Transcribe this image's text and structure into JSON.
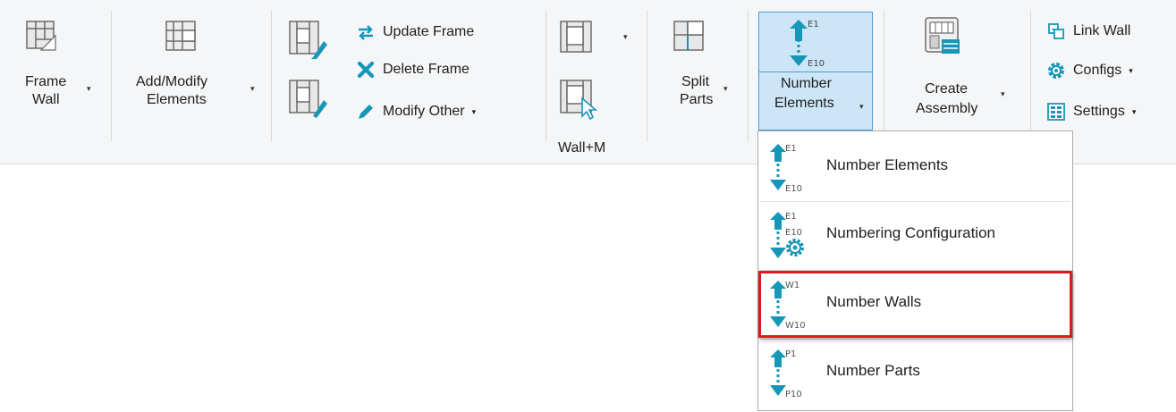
{
  "colors": {
    "accent_teal": "#1797b7",
    "active_bg": "#cde6f7",
    "active_border": "#4d9bd6",
    "highlight_red": "#e0191d"
  },
  "ribbon": {
    "frame_wall": {
      "line1": "Frame",
      "line2": "Wall",
      "icon": "frame-wall-icon"
    },
    "add_modify": {
      "line1": "Add/Modify",
      "line2": "Elements",
      "icon": "add-modify-elements-icon"
    },
    "update_frame": "Update Frame",
    "delete_frame": "Delete Frame",
    "modify_other": "Modify Other",
    "wall_m": "Wall+M",
    "split_parts": {
      "line1": "Split",
      "line2": "Parts"
    },
    "number_elements": {
      "line1": "Number",
      "line2": "Elements",
      "icon_top": "E1",
      "icon_bottom": "E10"
    },
    "create_assembly": {
      "line1": "Create",
      "line2": "Assembly"
    },
    "link_wall": "Link Wall",
    "configs": "Configs",
    "settings": "Settings",
    "dropdown_arrow": "▾"
  },
  "menu": {
    "items": [
      {
        "label": "Number Elements",
        "top": "E1",
        "bottom": "E10",
        "icon": "number-elements-icon"
      },
      {
        "label": "Numbering  Configuration",
        "top": "E1",
        "bottom": "E10",
        "icon": "numbering-configuration-icon"
      },
      {
        "label": "Number Walls",
        "top": "W1",
        "bottom": "W10",
        "icon": "number-walls-icon"
      },
      {
        "label": "Number Parts",
        "top": "P1",
        "bottom": "P10",
        "icon": "number-parts-icon"
      }
    ]
  }
}
